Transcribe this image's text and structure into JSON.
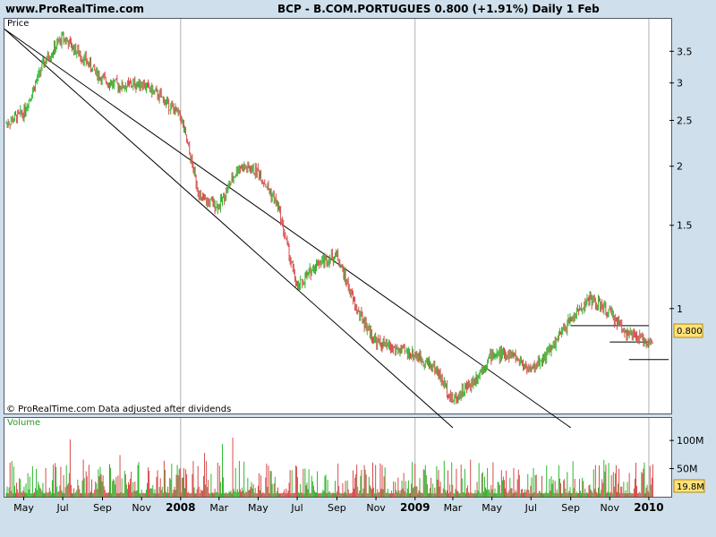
{
  "header": {
    "site": "www.ProRealTime.com",
    "symbol_line": "BCP - B.COM.PORTUGUES    0.800 (+1.91%)    Daily  1 Feb"
  },
  "price_panel": {
    "label": "Price",
    "copyright": "© ProRealTime.com  Data adjusted after dividends",
    "last_value": "0.800"
  },
  "volume_panel": {
    "label": "Volume",
    "last_value": "19.8M"
  },
  "colors": {
    "up": "#2eb82e",
    "down": "#d84a4a",
    "background": "#cfe0ec",
    "last_tag": "#ffe27a"
  },
  "chart_data": {
    "type": "candlestick-line",
    "title": "BCP - B.COM.PORTUGUES",
    "y_scale": "log",
    "y_ticks": [
      "3.5",
      "3",
      "2.5",
      "2",
      "1.5",
      "1"
    ],
    "y_tick_values": [
      3.5,
      3,
      2.5,
      2,
      1.5,
      1
    ],
    "ylim": [
      0.6,
      4.1
    ],
    "x_ticks": [
      "May",
      "Jul",
      "Sep",
      "Nov",
      "2008",
      "Mar",
      "May",
      "Jul",
      "Sep",
      "Nov",
      "2009",
      "Mar",
      "May",
      "Jul",
      "Sep",
      "Nov",
      "2010"
    ],
    "x_tick_dates": [
      "2007-05",
      "2007-07",
      "2007-09",
      "2007-11",
      "2008-01",
      "2008-03",
      "2008-05",
      "2008-07",
      "2008-09",
      "2008-11",
      "2009-01",
      "2009-03",
      "2009-05",
      "2009-07",
      "2009-09",
      "2009-11",
      "2010-01"
    ],
    "price_series": {
      "x": [
        "2007-04",
        "2007-05",
        "2007-06",
        "2007-07",
        "2007-08",
        "2007-09",
        "2007-10",
        "2007-11",
        "2007-12",
        "2008-01",
        "2008-02",
        "2008-03",
        "2008-04",
        "2008-05",
        "2008-06",
        "2008-07",
        "2008-08",
        "2008-09",
        "2008-10",
        "2008-11",
        "2008-12",
        "2009-01",
        "2009-02",
        "2009-03",
        "2009-04",
        "2009-05",
        "2009-06",
        "2009-07",
        "2009-08",
        "2009-09",
        "2009-10",
        "2009-11",
        "2009-12",
        "2010-01",
        "2010-02"
      ],
      "y": [
        2.45,
        2.6,
        3.3,
        3.75,
        3.4,
        3.05,
        2.95,
        3.0,
        2.8,
        2.55,
        1.7,
        1.65,
        2.0,
        1.95,
        1.65,
        1.1,
        1.25,
        1.3,
        1.0,
        0.85,
        0.82,
        0.8,
        0.75,
        0.64,
        0.7,
        0.8,
        0.8,
        0.74,
        0.82,
        0.95,
        1.05,
        0.98,
        0.88,
        0.85,
        0.8
      ]
    },
    "channel_lines": [
      {
        "from": [
          "2007-04",
          3.9
        ],
        "to": [
          "2009-09",
          0.56
        ]
      },
      {
        "from": [
          "2007-04",
          3.9
        ],
        "to": [
          "2009-03",
          0.56
        ]
      }
    ],
    "support_lines": [
      {
        "from": "2009-09",
        "to": "2010-01",
        "y": 0.92
      },
      {
        "from": "2009-11",
        "to": "2010-01",
        "y": 0.85
      },
      {
        "from": "2009-12",
        "to": "2010-02",
        "y": 0.78
      }
    ],
    "volume_ticks": [
      "100M",
      "50M"
    ],
    "volume_tick_values": [
      100,
      50
    ],
    "volume_ylim": [
      0,
      140
    ],
    "volume_unit": "M",
    "volume_last": 19.8,
    "grid": "vertical at year boundaries",
    "legend": "none"
  }
}
